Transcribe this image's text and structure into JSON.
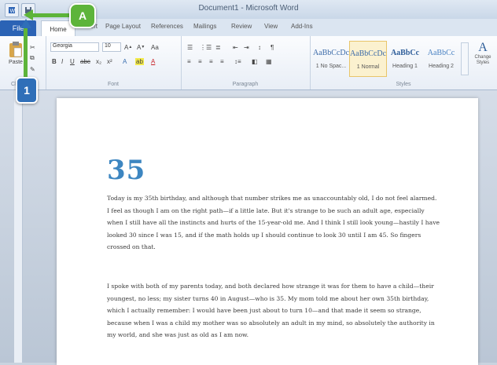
{
  "window": {
    "title": "Document1 - Microsoft Word"
  },
  "quick_access": {
    "icons": [
      "word-app-icon",
      "save-icon"
    ]
  },
  "tabs": [
    "File",
    "Home",
    "Insert",
    "Page Layout",
    "References",
    "Mailings",
    "Review",
    "View",
    "Add-Ins"
  ],
  "ribbon": {
    "clipboard": {
      "label": "Clipboard",
      "paste_label": "Paste"
    },
    "font": {
      "label": "Font",
      "font_name": "Georgia",
      "font_size": "10"
    },
    "paragraph": {
      "label": "Paragraph"
    },
    "styles": {
      "label": "Styles",
      "items": [
        {
          "sample": "AaBbCcDc",
          "name": "1 No Spac..."
        },
        {
          "sample": "AaBbCcDc",
          "name": "1 Normal"
        },
        {
          "sample": "AaBbCc",
          "name": "Heading 1"
        },
        {
          "sample": "AaBbCc",
          "name": "Heading 2"
        }
      ],
      "change_styles_label": "Change Styles"
    }
  },
  "document": {
    "chapter_number": "35",
    "paragraphs": [
      "Today is my 35th birthday, and although that number strikes me as unaccountably old, I do not feel alarmed. I feel as though I am on the right path—if a little late. But it's strange to be such an adult age, especially when I still have all the instincts and hurts of the 15-year-old me. And I think I still look young—hastily I have looked 30 since I was 15, and if the math holds up I should continue to look 30 until I am 45. So fingers crossed on that.",
      "I spoke with both of my parents today, and both declared how strange it was for them to have a child—their youngest, no less; my sister turns 40 in August—who is 35. My mom told me about her own 35th birthday, which I actually remember: I would have been just about to turn 10—and that made it seem so strange, because when I was a child my mother was so absolutely an adult in my mind, so absolutely the authority in my world, and she was just as old as I am now."
    ]
  },
  "callouts": {
    "a": "A",
    "one": "1"
  },
  "colors": {
    "file_tab": "#2b63b5",
    "callout": "#5db43a",
    "chapter_number": "#3d86c1"
  }
}
